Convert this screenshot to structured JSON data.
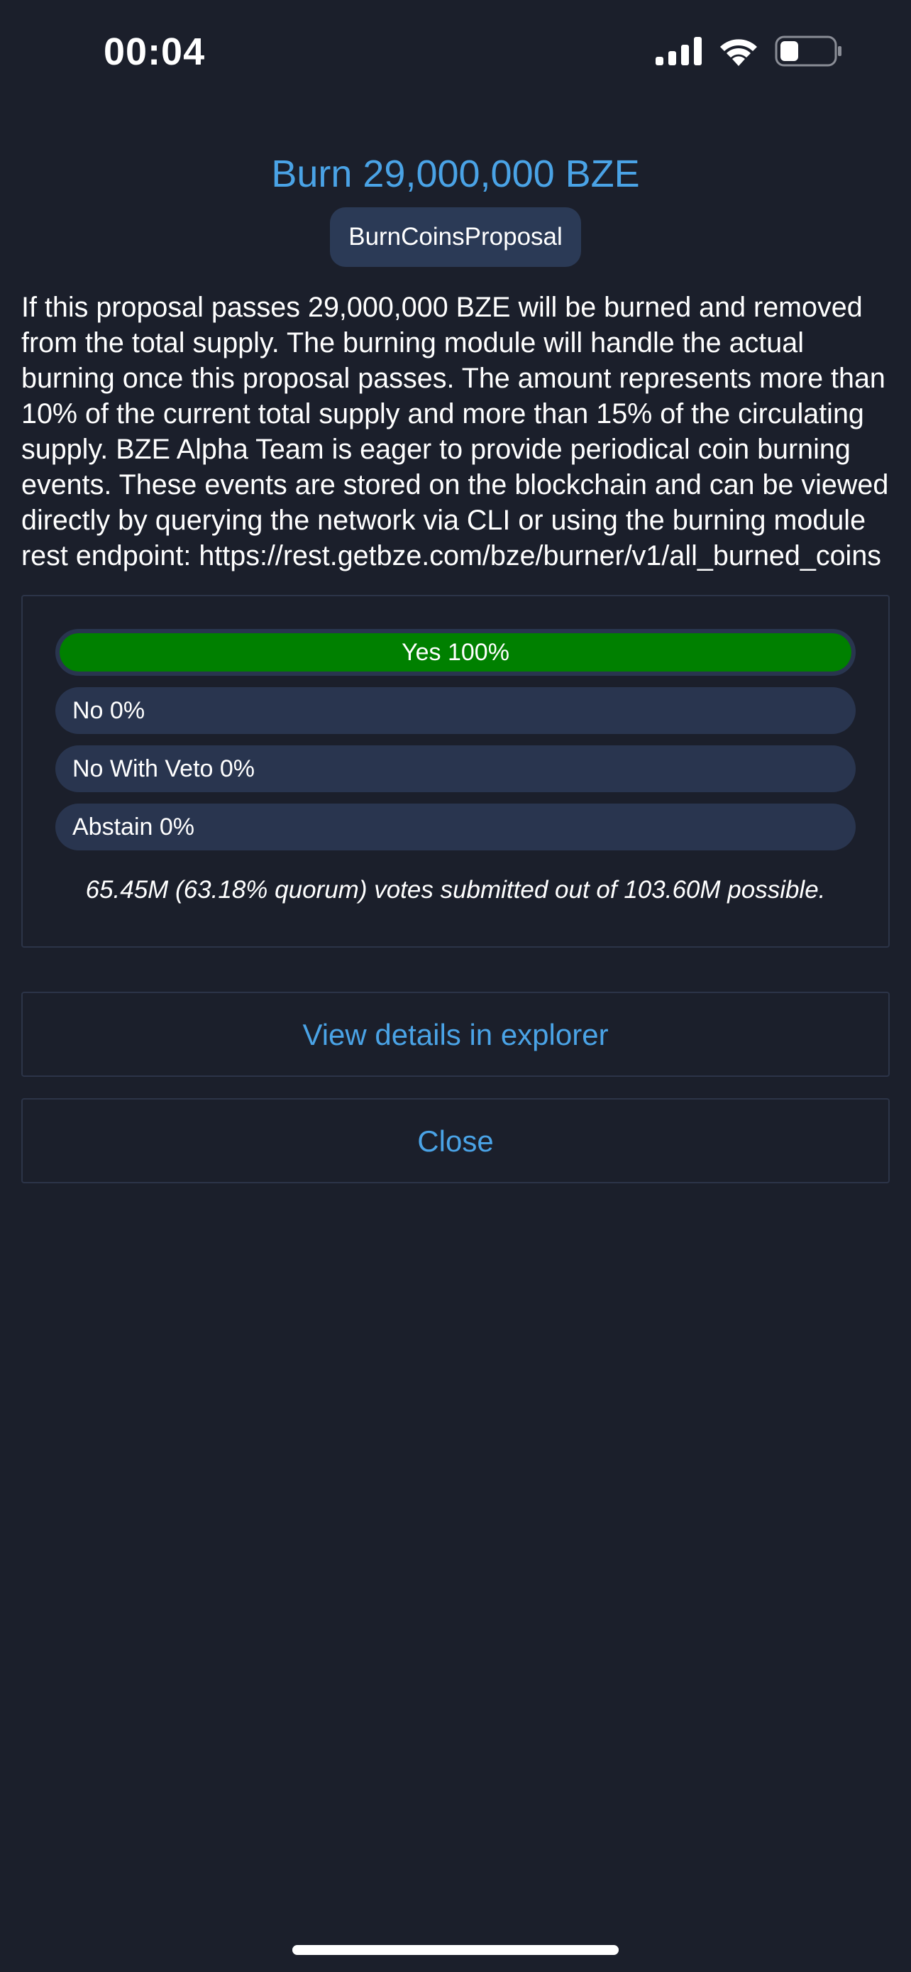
{
  "status_bar": {
    "time": "00:04",
    "icons": [
      "signal-icon",
      "wifi-icon",
      "battery-icon"
    ],
    "battery_level": 0.35
  },
  "proposal": {
    "title": "Burn 29,000,000 BZE",
    "type": "BurnCoinsProposal",
    "description": "If this proposal passes 29,000,000 BZE will be burned and removed from the total supply. The burning module will handle the actual burning once this proposal passes. The amount represents more than 10% of the current total supply and more than 15% of the circulating supply. BZE Alpha Team is eager to provide periodical coin burning events. These events are stored on the blockchain and can be viewed directly by querying the network via CLI or using the burning module rest endpoint: https://rest.getbze.com/bze/burner/v1/all_burned_coins"
  },
  "votes": {
    "options": [
      {
        "label": "Yes 100%",
        "percent": 100,
        "color": "#008000"
      },
      {
        "label": "No 0%",
        "percent": 0,
        "color": "#29354f"
      },
      {
        "label": "No With Veto 0%",
        "percent": 0,
        "color": "#29354f"
      },
      {
        "label": "Abstain 0%",
        "percent": 0,
        "color": "#29354f"
      }
    ],
    "quorum_note": "65.45M (63.18% quorum) votes submitted out of 103.60M possible."
  },
  "actions": {
    "explorer_label": "View details in explorer",
    "close_label": "Close"
  },
  "colors": {
    "background": "#1b1f2b",
    "accent": "#4aa3e6",
    "yes_fill": "#008000",
    "bar_track": "#29354f"
  }
}
